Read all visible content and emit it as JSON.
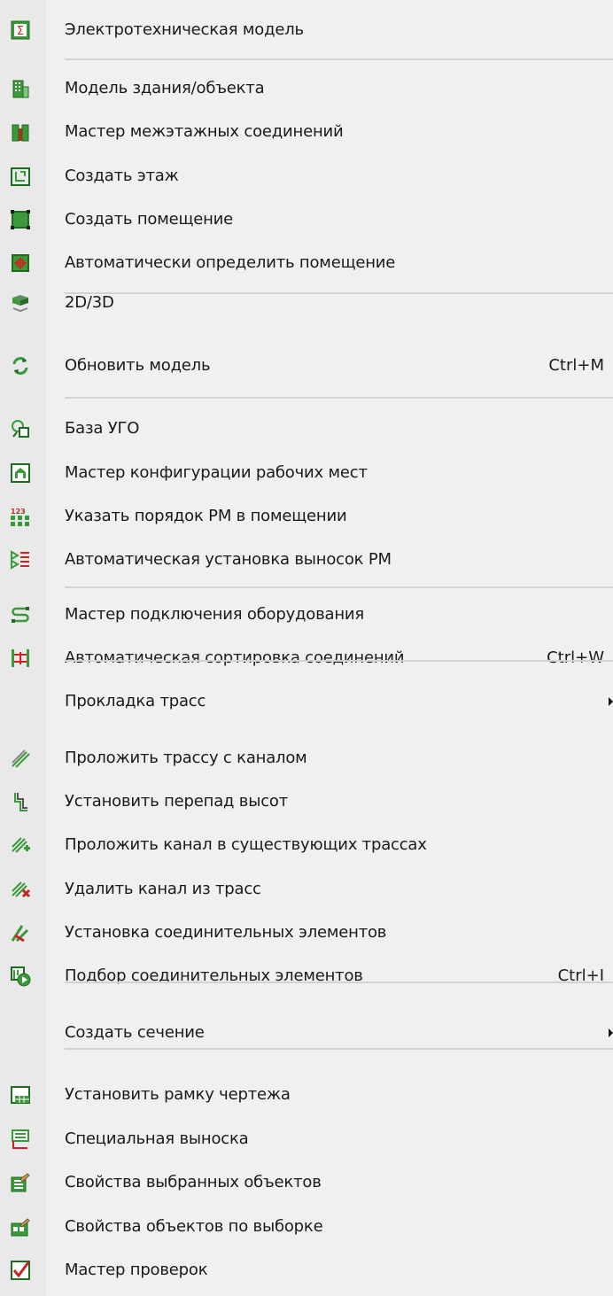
{
  "menu": {
    "items": [
      {
        "label": "Электротехническая модель",
        "icon": "electrical-model-icon",
        "shortcut": ""
      },
      {
        "label": "Модель здания/объекта",
        "icon": "building-model-icon",
        "shortcut": ""
      },
      {
        "label": "Мастер межэтажных соединений",
        "icon": "interfloor-connections-icon",
        "shortcut": ""
      },
      {
        "label": "Создать этаж",
        "icon": "create-floor-icon",
        "shortcut": ""
      },
      {
        "label": "Создать помещение",
        "icon": "create-room-icon",
        "shortcut": ""
      },
      {
        "label": "Автоматически определить помещение",
        "icon": "auto-detect-room-icon",
        "shortcut": ""
      },
      {
        "label": "2D/3D",
        "icon": "view-2d-3d-icon",
        "shortcut": ""
      },
      {
        "label": "Обновить модель",
        "icon": "refresh-model-icon",
        "shortcut": "Ctrl+M"
      },
      {
        "label": "База УГО",
        "icon": "symbol-library-icon",
        "shortcut": ""
      },
      {
        "label": "Мастер конфигурации рабочих мест",
        "icon": "workplace-config-icon",
        "shortcut": ""
      },
      {
        "label": "Указать порядок РМ в помещении",
        "icon": "workplace-order-icon",
        "shortcut": ""
      },
      {
        "label": "Автоматическая установка выносок РМ",
        "icon": "auto-callouts-icon",
        "shortcut": ""
      },
      {
        "label": "Мастер подключения оборудования",
        "icon": "equipment-connection-icon",
        "shortcut": ""
      },
      {
        "label": "Автоматическая сортировка соединений",
        "icon": "sort-connections-icon",
        "shortcut": "Ctrl+W"
      },
      {
        "label": "Прокладка трасс",
        "icon": "",
        "shortcut": "",
        "submenu": true
      },
      {
        "label": "Проложить трассу с каналом",
        "icon": "route-with-channel-icon",
        "shortcut": ""
      },
      {
        "label": "Установить перепад высот",
        "icon": "height-difference-icon",
        "shortcut": ""
      },
      {
        "label": "Проложить канал в существующих трассах",
        "icon": "channel-in-routes-icon",
        "shortcut": ""
      },
      {
        "label": "Удалить канал из трасс",
        "icon": "delete-channel-icon",
        "shortcut": ""
      },
      {
        "label": "Установка соединительных элементов",
        "icon": "install-connectors-icon",
        "shortcut": ""
      },
      {
        "label": "Подбор соединительных элементов",
        "icon": "select-connectors-icon",
        "shortcut": "Ctrl+I"
      },
      {
        "label": "Создать сечение",
        "icon": "",
        "shortcut": "",
        "submenu": true
      },
      {
        "label": "Установить рамку чертежа",
        "icon": "drawing-frame-icon",
        "shortcut": ""
      },
      {
        "label": "Специальная выноска",
        "icon": "special-callout-icon",
        "shortcut": ""
      },
      {
        "label": "Свойства выбранных объектов",
        "icon": "selected-properties-icon",
        "shortcut": ""
      },
      {
        "label": "Свойства объектов по выборке",
        "icon": "query-properties-icon",
        "shortcut": ""
      },
      {
        "label": "Мастер проверок",
        "icon": "checks-wizard-icon",
        "shortcut": ""
      }
    ]
  },
  "colors": {
    "background": "#f0f0f0",
    "separator": "#d2d2d2",
    "accent_green": "#3a9a3a",
    "accent_red": "#cc2222"
  }
}
